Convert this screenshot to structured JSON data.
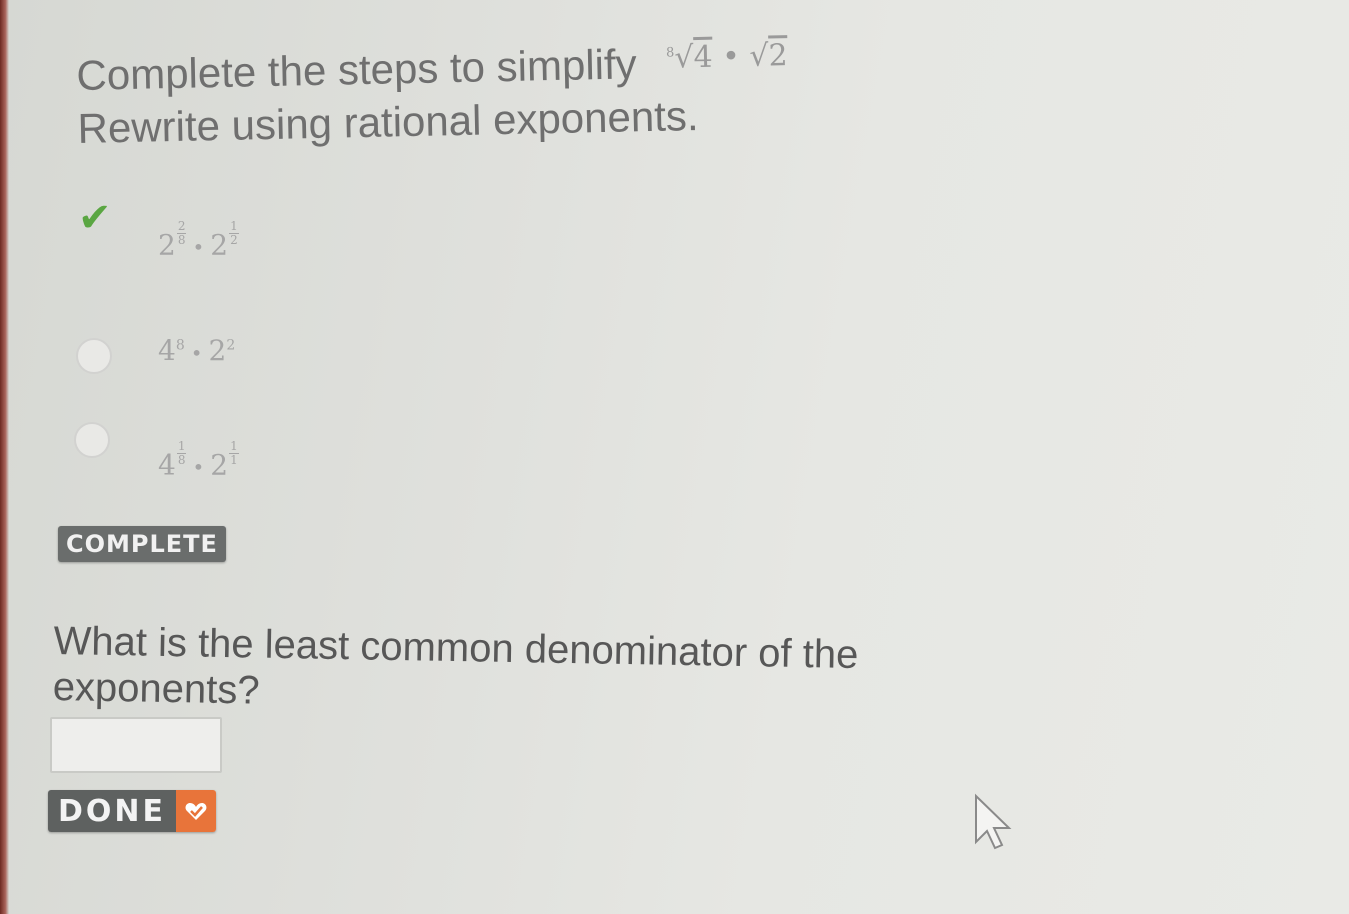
{
  "prompt": {
    "line1": "Complete the steps to simplify",
    "expression": {
      "radical1_index": "8",
      "radical1_radicand": "4",
      "operator": "•",
      "radical2_radicand": "2"
    },
    "line2": "Rewrite using rational exponents."
  },
  "options": [
    {
      "selected": true,
      "base1": "2",
      "exp1_num": "2",
      "exp1_den": "8",
      "operator": "•",
      "base2": "2",
      "exp2_num": "1",
      "exp2_den": "2"
    },
    {
      "selected": false,
      "base1": "4",
      "exp1": "8",
      "operator": "•",
      "base2": "2",
      "exp2": "2"
    },
    {
      "selected": false,
      "base1": "4",
      "exp1_num": "1",
      "exp1_den": "8",
      "operator": "•",
      "base2": "2",
      "exp2_num": "1",
      "exp2_den": "1"
    }
  ],
  "status_badge": "COMPLETE",
  "question": "What is the least common denominator of the exponents?",
  "answer": {
    "value": "",
    "placeholder": ""
  },
  "done_button": {
    "label": "DONE"
  },
  "colors": {
    "check": "#5aa642",
    "done_accent": "#e8743a",
    "badge_bg": "#6a6d6c"
  },
  "icons": {
    "selected_marker": "checkmark-icon",
    "done_icon": "checkmark-icon",
    "pointer": "mouse-cursor-icon"
  }
}
